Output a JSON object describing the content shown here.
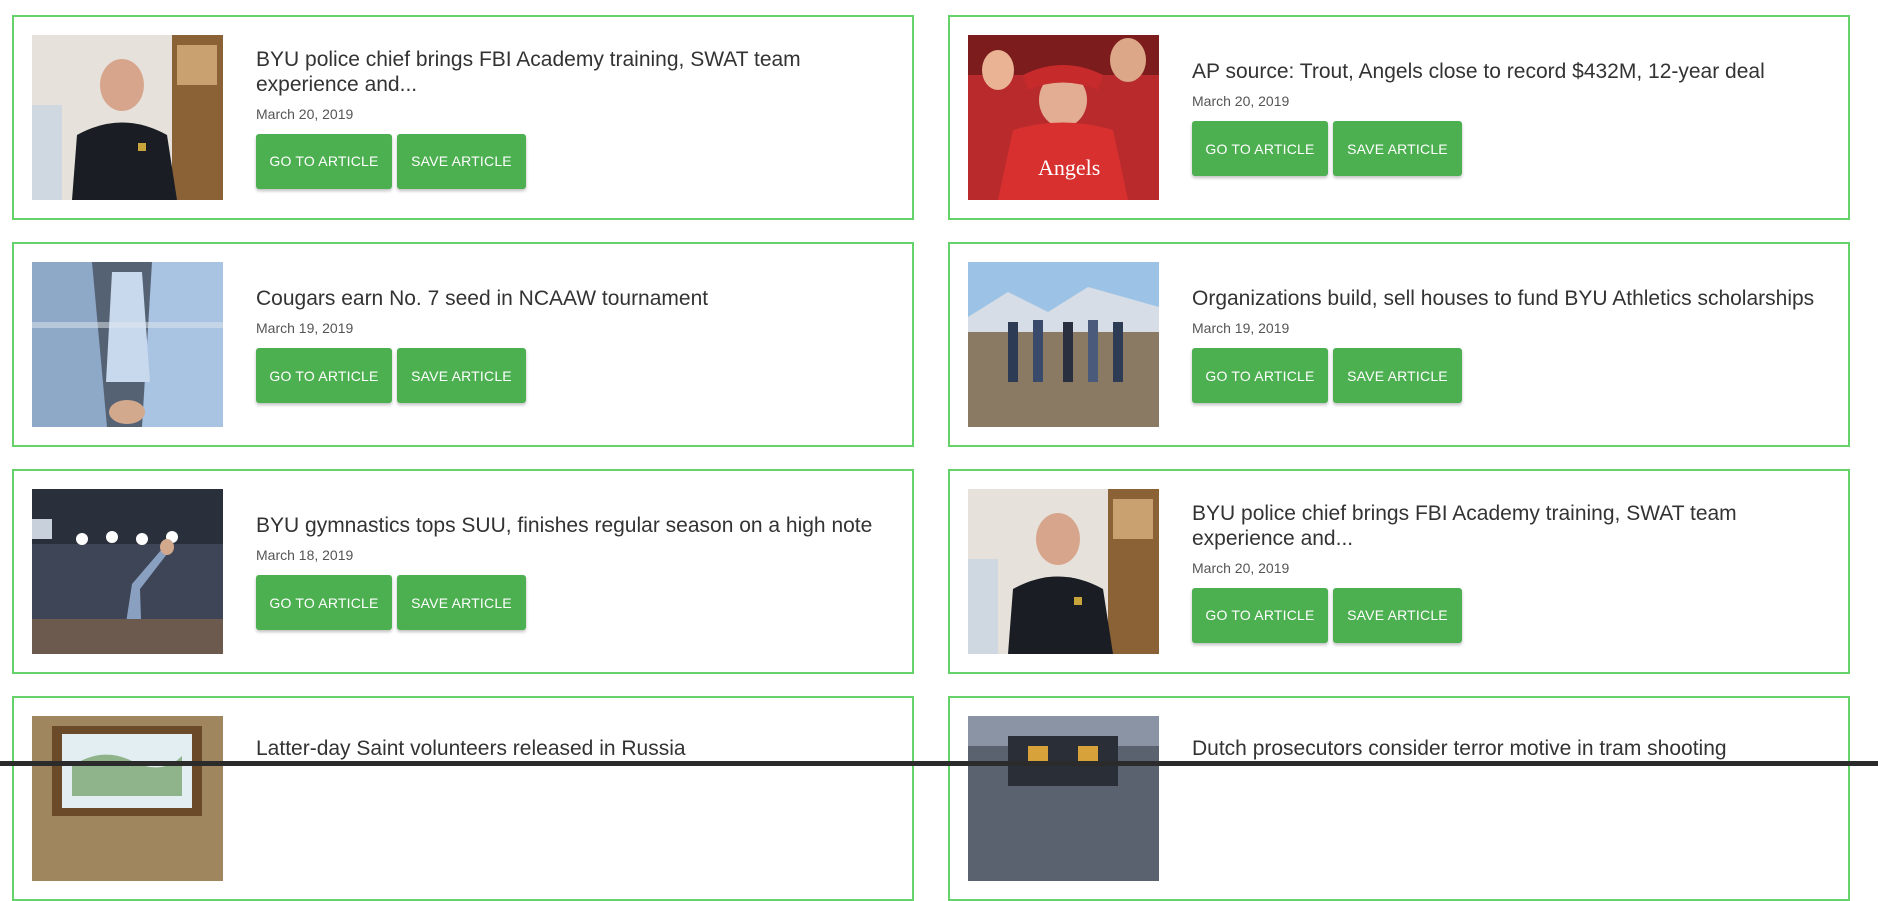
{
  "articles": [
    {
      "title": "BYU police chief brings FBI Academy training, SWAT team experience and...",
      "date": "March 20, 2019",
      "go_label": "GO TO ARTICLE",
      "save_label": "SAVE ARTICLE"
    },
    {
      "title": "AP source: Trout, Angels close to record $432M, 12-year deal",
      "date": "March 20, 2019",
      "go_label": "GO TO ARTICLE",
      "save_label": "SAVE ARTICLE"
    },
    {
      "title": "Cougars earn No. 7 seed in NCAAW tournament",
      "date": "March 19, 2019",
      "go_label": "GO TO ARTICLE",
      "save_label": "SAVE ARTICLE"
    },
    {
      "title": "Organizations build, sell houses to fund BYU Athletics scholarships",
      "date": "March 19, 2019",
      "go_label": "GO TO ARTICLE",
      "save_label": "SAVE ARTICLE"
    },
    {
      "title": "BYU gymnastics tops SUU, finishes regular season on a high note",
      "date": "March 18, 2019",
      "go_label": "GO TO ARTICLE",
      "save_label": "SAVE ARTICLE"
    },
    {
      "title": "BYU police chief brings FBI Academy training, SWAT team experience and...",
      "date": "March 20, 2019",
      "go_label": "GO TO ARTICLE",
      "save_label": "SAVE ARTICLE"
    },
    {
      "title": "Latter-day Saint volunteers released in Russia",
      "date": "",
      "go_label": "",
      "save_label": ""
    },
    {
      "title": "Dutch prosecutors consider terror motive in tram shooting",
      "date": "",
      "go_label": "",
      "save_label": ""
    }
  ],
  "colors": {
    "card_border": "#66d36a",
    "button": "#4caf50",
    "text": "#333333"
  }
}
